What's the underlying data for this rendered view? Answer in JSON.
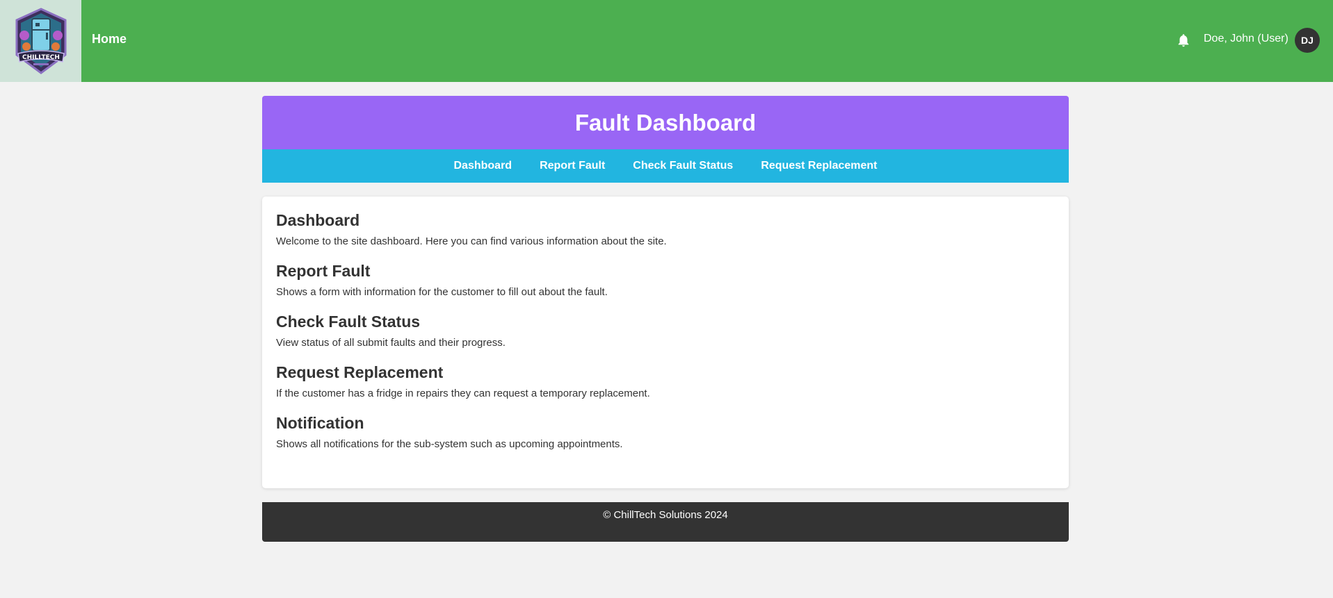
{
  "header": {
    "logo_text": "CHILLTECH",
    "home_label": "Home",
    "user_name": "Doe, John (User)",
    "avatar_initials": "DJ",
    "bell_icon": "bell-icon",
    "bar_color": "#4caf50"
  },
  "dashboard": {
    "title": "Fault Dashboard",
    "title_color": "#9966f5",
    "nav_color": "#22b5e0",
    "nav": [
      {
        "label": "Dashboard"
      },
      {
        "label": "Report Fault"
      },
      {
        "label": "Check Fault Status"
      },
      {
        "label": "Request Replacement"
      }
    ]
  },
  "sections": [
    {
      "heading": "Dashboard",
      "text": "Welcome to the site dashboard. Here you can find various information about the site."
    },
    {
      "heading": "Report Fault",
      "text": "Shows a form with information for the customer to fill out about the fault."
    },
    {
      "heading": "Check Fault Status",
      "text": "View status of all submit faults and their progress."
    },
    {
      "heading": "Request Replacement",
      "text": "If the customer has a fridge in repairs they can request a temporary replacement."
    },
    {
      "heading": "Notification",
      "text": "Shows all notifications for the sub-system such as upcoming appointments."
    }
  ],
  "footer": {
    "text": "© ChillTech Solutions 2024"
  }
}
